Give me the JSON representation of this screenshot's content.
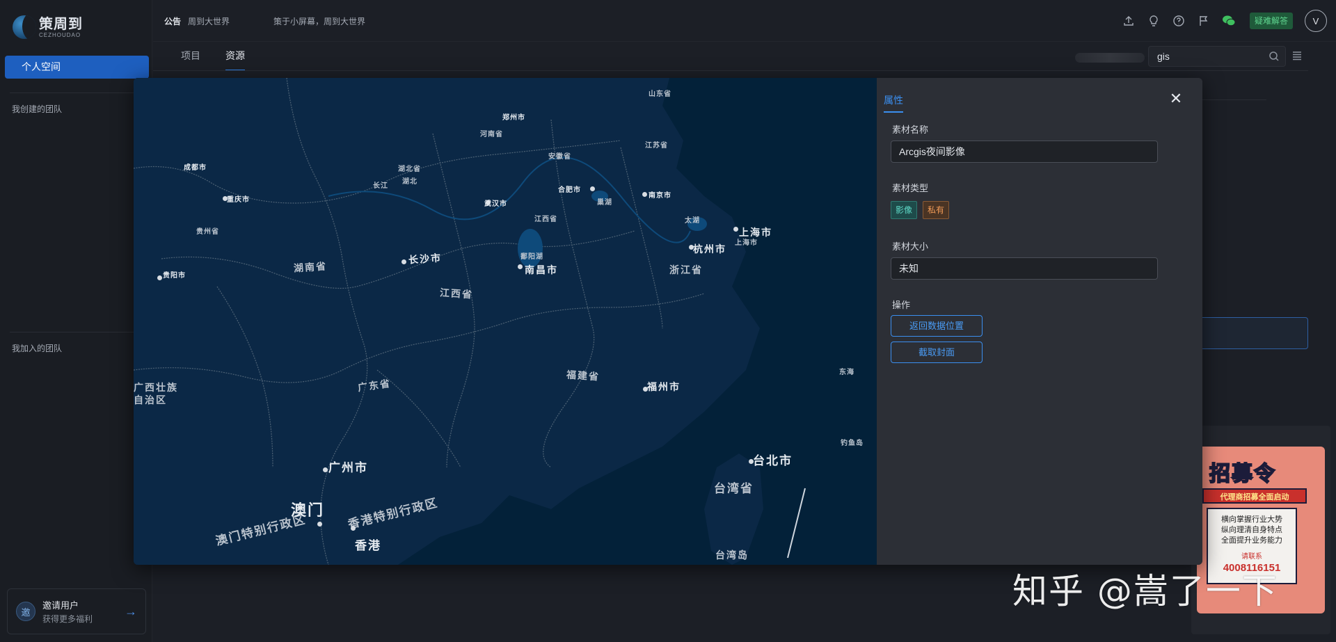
{
  "app": {
    "logo_cn": "策周到",
    "logo_en": "CEZHOUDAO"
  },
  "sidebar": {
    "personal_space": "个人空间",
    "created_teams": "我创建的团队",
    "joined_teams": "我加入的团队",
    "invite": {
      "icon_text": "邀",
      "title": "邀请用户",
      "subtitle": "获得更多福利"
    }
  },
  "topbar": {
    "notice_tag": "公告",
    "notice_title": "周到大世界",
    "notice_text": "策于小屏幕，周到大世界",
    "qa_button": "疑难解答",
    "avatar_letter": "V"
  },
  "tabs": [
    {
      "label": "项目",
      "active": false
    },
    {
      "label": "资源",
      "active": true
    }
  ],
  "search": {
    "value": "gis"
  },
  "modal": {
    "props_tab": "属性",
    "name_label": "素材名称",
    "name_value": "Arcgis夜间影像",
    "type_label": "素材类型",
    "type_tags": [
      "影像",
      "私有"
    ],
    "size_label": "素材大小",
    "size_value": "未知",
    "ops_label": "操作",
    "ops": [
      "返回数据位置",
      "截取封面"
    ]
  },
  "map_labels": {
    "provinces": [
      "湖南省",
      "江西省",
      "浙江省",
      "福建省",
      "广东省",
      "台湾省",
      "湖北省",
      "安徽省",
      "江苏省",
      "河南省",
      "山东省",
      "贵州省",
      "广西壮族自治区",
      "香港特别行政区",
      "澳门特别行政区"
    ],
    "cities": [
      "长沙市",
      "南昌市",
      "杭州市",
      "上海市",
      "福州市",
      "广州市",
      "台北市",
      "澳门",
      "香港",
      "武汉市",
      "合肥市",
      "南京市",
      "重庆市",
      "贵阳市",
      "郑州市",
      "成都市"
    ],
    "others": [
      "东海",
      "钓鱼岛",
      "台湾岛",
      "巢湖",
      "太湖",
      "鄱阳湖",
      "长江",
      "上海市",
      "江西省",
      "湖北"
    ]
  },
  "ad": {
    "title": "招募令",
    "ribbon": "代理商招募全面启动",
    "lines": [
      "横向掌握行业大势",
      "纵向理清自身特点",
      "全面提升业务能力"
    ],
    "contact": "请联系",
    "phone": "4008116151"
  },
  "watermark": "知乎 @嵩了一下",
  "colors": {
    "primary": "#1e5fbf",
    "accent": "#3b8ff0",
    "qa_green": "#5fd48f",
    "map_sea": "#032139",
    "map_land": "#0c2a4a"
  }
}
